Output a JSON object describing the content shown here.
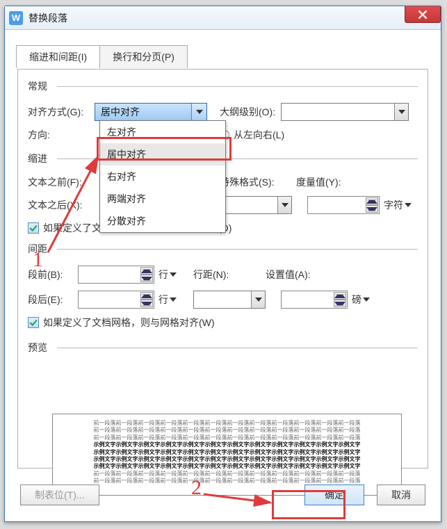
{
  "window": {
    "title": "替换段落"
  },
  "tabs": {
    "indent": "缩进和间距(I)",
    "pagebreak": "换行和分页(P)"
  },
  "sections": {
    "general": "常规",
    "indent": "缩进",
    "spacing": "间距",
    "preview": "预览"
  },
  "labels": {
    "alignment": "对齐方式(G):",
    "outline": "大纲级别(O):",
    "direction": "方向:",
    "ltr": "从左向右(L)",
    "textBefore": "文本之前(F):",
    "textAfter": "文本之后(X):",
    "special": "特殊格式(S):",
    "by": "度量值(Y):",
    "unitChar": "字符",
    "before": "段前(B):",
    "after": "段后(E):",
    "unitLine": "行",
    "lineSpacing": "行距(N):",
    "setAt": "设置值(A):",
    "unitPound": "磅",
    "autoIndent": "如果定义了文档网格，则自动调整右缩进(D)",
    "snapGrid": "如果定义了文档网格，则与网格对齐(W)"
  },
  "alignment": {
    "selected": "居中对齐",
    "options": {
      "left": "左对齐",
      "center": "居中对齐",
      "right": "右对齐",
      "justify": "两端对齐",
      "distribute": "分散对齐"
    }
  },
  "markers": {
    "one": "1",
    "two": "2"
  },
  "buttons": {
    "tabs": "制表位(T)...",
    "ok": "确定",
    "cancel": "取消"
  },
  "preview": {
    "light": "前一段落前一段落前一段落前一段落前一段落前一段落前一段落前一段落前一段落前一段落前一段落前一段落",
    "bold": "示例文字示例文字示例文字示例文字示例文字示例文字示例文字示例文字示例文字示例文字示例文字示例文字"
  }
}
